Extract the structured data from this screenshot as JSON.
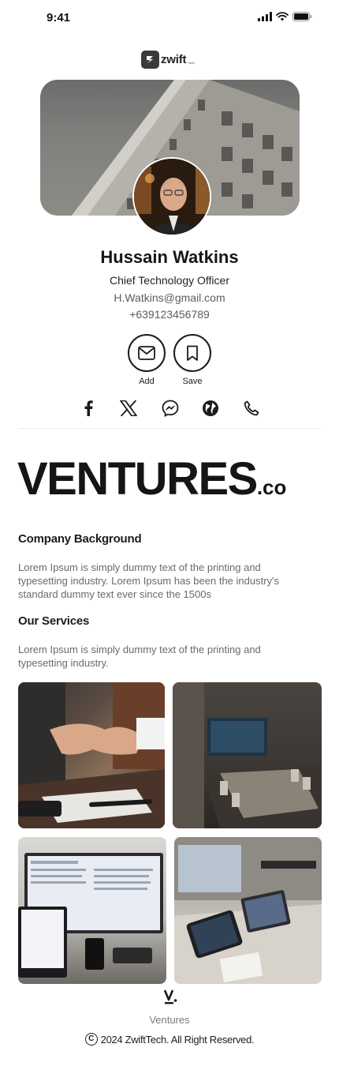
{
  "status": {
    "time": "9:41"
  },
  "logo": {
    "text": "zwift",
    "sub": "Tech"
  },
  "profile": {
    "name": "Hussain Watkins",
    "title": "Chief Technology Officer",
    "email": "H.Watkins@gmail.com",
    "phone": "+639123456789"
  },
  "actions": [
    {
      "label": "Add",
      "icon": "mail-icon"
    },
    {
      "label": "Save",
      "icon": "bookmark-icon"
    }
  ],
  "social": [
    "facebook-icon",
    "x-icon",
    "messenger-icon",
    "globe-icon",
    "phone-icon"
  ],
  "brand": {
    "name": "VENTURES",
    "suffix": ".co"
  },
  "sections": [
    {
      "heading": "Company Background",
      "text": "Lorem Ipsum is simply dummy text of the printing and typesetting industry. Lorem Ipsum has been the industry's standard dummy text ever since the 1500s"
    },
    {
      "heading": "Our Services",
      "text": "Lorem Ipsum is simply dummy text of the printing and typesetting industry."
    }
  ],
  "footer": {
    "brand": "Ventures",
    "copyright": "2024 ZwiftTech. All Right Reserved.",
    "copyright_symbol": "C"
  },
  "colors": {
    "text": "#1b1b1b",
    "muted": "#6a6a6a",
    "divider": "#ececec"
  }
}
